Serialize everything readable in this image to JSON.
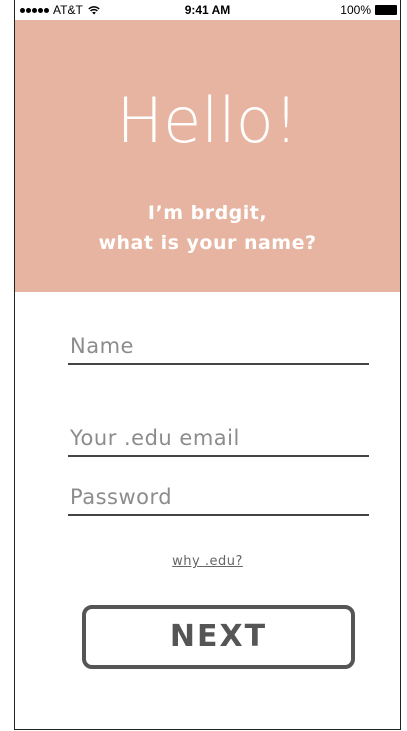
{
  "status_bar": {
    "carrier": "AT&T",
    "time": "9:41 AM",
    "battery": "100%"
  },
  "hero": {
    "title": "Hello!",
    "subtitle_line1": "I’m brdgit,",
    "subtitle_line2": "what is your name?",
    "background_color": "#e6b4a1"
  },
  "form": {
    "name_placeholder": "Name",
    "name_value": "",
    "email_placeholder": "Your .edu email",
    "email_value": "",
    "password_placeholder": "Password",
    "password_value": ""
  },
  "links": {
    "why_edu": "why .edu?"
  },
  "buttons": {
    "next_label": "NEXT"
  },
  "icons": {
    "signal": "signal-icon",
    "wifi": "wifi-icon",
    "battery": "battery-icon"
  }
}
